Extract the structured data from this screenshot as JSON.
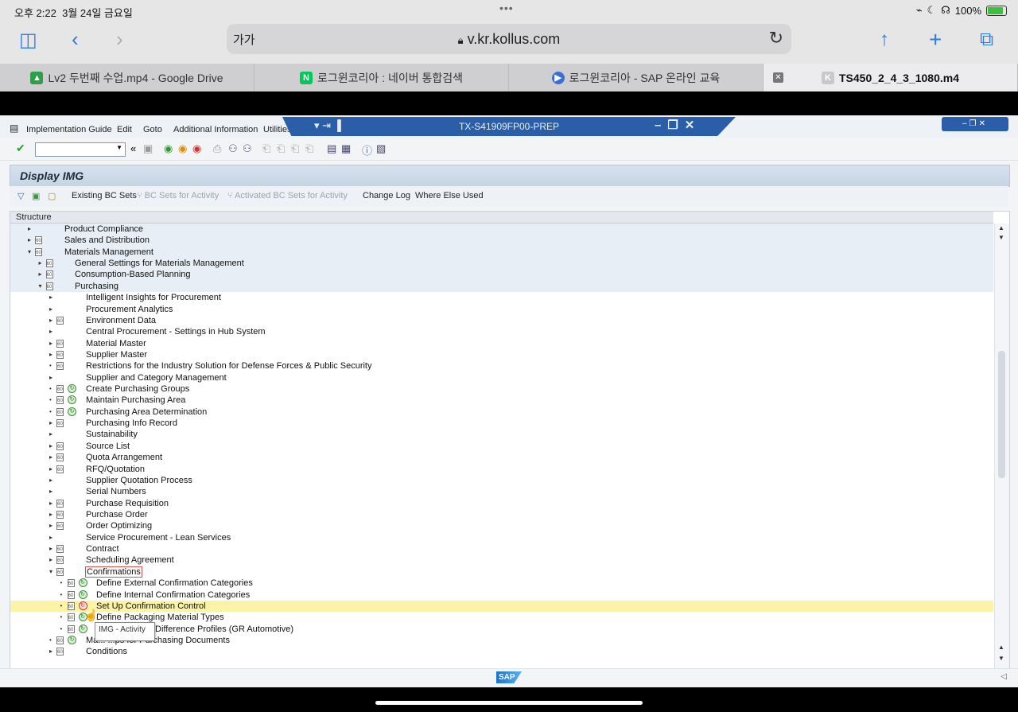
{
  "status_bar": {
    "time": "오후 2:22",
    "date": "3월 24일 금요일",
    "dots": "•••",
    "battery": "100%"
  },
  "safari": {
    "aa": "가가",
    "url": "v.kr.kollus.com"
  },
  "tabs": [
    {
      "title": "Lv2 두번째 수업.mp4 - Google Drive",
      "favicon": "google-drive-icon",
      "color": "#2f9e4a"
    },
    {
      "title": "로그윈코리아 : 네이버 통합검색",
      "favicon": "naver-icon",
      "color": "#03c75a"
    },
    {
      "title": "로그윈코리아 - SAP 온라인 교육",
      "favicon": "play-icon",
      "color": "#3b6fd6"
    },
    {
      "title": "TS450_2_4_3_1080.m4",
      "favicon": "k-icon",
      "color": "#c8c8cc",
      "active": true
    }
  ],
  "sap": {
    "menu": [
      "Implementation Guide",
      "Edit",
      "Goto",
      "Additional Information",
      "Utilities"
    ],
    "window_title": "TX-S41909FP00-PREP",
    "screen_title": "Display IMG",
    "app_toolbar": [
      {
        "label": "Existing BC Sets",
        "enabled": true
      },
      {
        "label": "BC Sets for Activity",
        "enabled": false
      },
      {
        "label": "Activated BC Sets for Activity",
        "enabled": false
      },
      {
        "label": "Change Log",
        "enabled": true
      },
      {
        "label": "Where Else Used",
        "enabled": true
      }
    ],
    "tree_header": "Structure",
    "tree": [
      {
        "label": "Product Compliance",
        "level": 0,
        "tri": "right",
        "doc": false,
        "act": false,
        "shaded": true
      },
      {
        "label": "Sales and Distribution",
        "level": 0,
        "tri": "right",
        "doc": true,
        "act": false,
        "shaded": true
      },
      {
        "label": "Materials Management",
        "level": 0,
        "tri": "down",
        "doc": true,
        "act": false,
        "shaded": true
      },
      {
        "label": "General Settings for Materials Management",
        "level": 1,
        "tri": "right",
        "doc": true,
        "act": false,
        "shaded": true
      },
      {
        "label": "Consumption-Based Planning",
        "level": 1,
        "tri": "right",
        "doc": true,
        "act": false,
        "shaded": true
      },
      {
        "label": "Purchasing",
        "level": 1,
        "tri": "down",
        "doc": true,
        "act": false,
        "shaded": true
      },
      {
        "label": "Intelligent Insights for Procurement",
        "level": 2,
        "tri": "right",
        "doc": false,
        "act": false
      },
      {
        "label": "Procurement Analytics",
        "level": 2,
        "tri": "right",
        "doc": false,
        "act": false
      },
      {
        "label": "Environment Data",
        "level": 2,
        "tri": "right",
        "doc": true,
        "act": false
      },
      {
        "label": "Central Procurement - Settings in Hub System",
        "level": 2,
        "tri": "right",
        "doc": false,
        "act": false
      },
      {
        "label": "Material Master",
        "level": 2,
        "tri": "right",
        "doc": true,
        "act": false
      },
      {
        "label": "Supplier Master",
        "level": 2,
        "tri": "right",
        "doc": true,
        "act": false
      },
      {
        "label": "Restrictions for the Industry Solution for Defense Forces & Public Security",
        "level": 2,
        "tri": "dot",
        "doc": true,
        "act": false
      },
      {
        "label": "Supplier and Category Management",
        "level": 2,
        "tri": "right",
        "doc": false,
        "act": false
      },
      {
        "label": "Create Purchasing Groups",
        "level": 2,
        "tri": "dot",
        "doc": true,
        "act": true
      },
      {
        "label": "Maintain Purchasing Area",
        "level": 2,
        "tri": "dot",
        "doc": true,
        "act": true
      },
      {
        "label": "Purchasing Area Determination",
        "level": 2,
        "tri": "dot",
        "doc": true,
        "act": true
      },
      {
        "label": "Purchasing Info Record",
        "level": 2,
        "tri": "right",
        "doc": true,
        "act": false
      },
      {
        "label": "Sustainability",
        "level": 2,
        "tri": "right",
        "doc": false,
        "act": false
      },
      {
        "label": "Source List",
        "level": 2,
        "tri": "right",
        "doc": true,
        "act": false
      },
      {
        "label": "Quota Arrangement",
        "level": 2,
        "tri": "right",
        "doc": true,
        "act": false
      },
      {
        "label": "RFQ/Quotation",
        "level": 2,
        "tri": "right",
        "doc": true,
        "act": false
      },
      {
        "label": "Supplier Quotation Process",
        "level": 2,
        "tri": "right",
        "doc": false,
        "act": false
      },
      {
        "label": "Serial Numbers",
        "level": 2,
        "tri": "right",
        "doc": false,
        "act": false
      },
      {
        "label": "Purchase Requisition",
        "level": 2,
        "tri": "right",
        "doc": true,
        "act": false
      },
      {
        "label": "Purchase Order",
        "level": 2,
        "tri": "right",
        "doc": true,
        "act": false
      },
      {
        "label": "Order Optimizing",
        "level": 2,
        "tri": "right",
        "doc": true,
        "act": false
      },
      {
        "label": "Service Procurement - Lean Services",
        "level": 2,
        "tri": "right",
        "doc": false,
        "act": false
      },
      {
        "label": "Contract",
        "level": 2,
        "tri": "right",
        "doc": true,
        "act": false
      },
      {
        "label": "Scheduling Agreement",
        "level": 2,
        "tri": "right",
        "doc": true,
        "act": false
      },
      {
        "label": "Confirmations",
        "level": 2,
        "tri": "down",
        "doc": true,
        "act": false,
        "boxed": true
      },
      {
        "label": "Define External Confirmation Categories",
        "level": 3,
        "tri": "dot",
        "doc": true,
        "act": true
      },
      {
        "label": "Define Internal Confirmation Categories",
        "level": 3,
        "tri": "dot",
        "doc": true,
        "act": true
      },
      {
        "label": "Set Up Confirmation Control",
        "level": 3,
        "tri": "dot",
        "doc": true,
        "act": true,
        "selected": true,
        "act_red": true
      },
      {
        "label": "Define Packaging Material Types",
        "level": 3,
        "tri": "dot",
        "doc": true,
        "act": true
      },
      {
        "label": "Difference Profiles (GR Automotive)",
        "level": 3,
        "tri": "dot",
        "doc": true,
        "act": true,
        "offset_label": true
      },
      {
        "label": "Ma... ...ps for Purchasing Documents",
        "level": 2,
        "tri": "dot",
        "doc": true,
        "act": true
      },
      {
        "label": "Conditions",
        "level": 2,
        "tri": "right",
        "doc": true,
        "act": false
      }
    ],
    "tooltip": "IMG - Activity",
    "logo": "SAP"
  }
}
